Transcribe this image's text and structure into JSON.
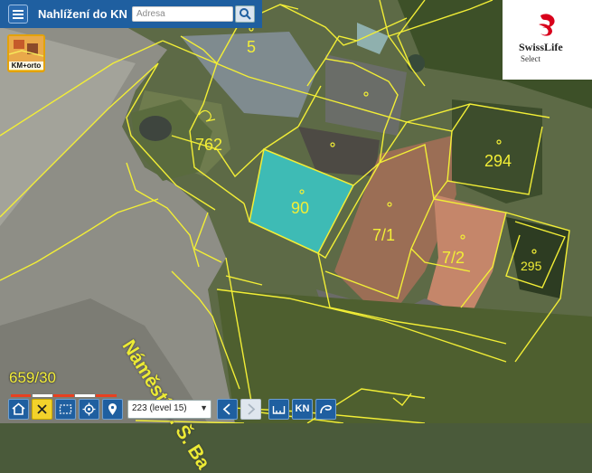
{
  "header": {
    "title": "Nahlížení do KN",
    "search_placeholder": "Adresa"
  },
  "brand": {
    "name": "SwissLife",
    "sub": "Select"
  },
  "layer_button": {
    "label": "KM+orto"
  },
  "map": {
    "parcels": [
      {
        "id": "5"
      },
      {
        "id": "762"
      },
      {
        "id": "90",
        "selected": true
      },
      {
        "id": "294"
      },
      {
        "id": "7/1"
      },
      {
        "id": "7/2"
      },
      {
        "id": "295"
      },
      {
        "id": "659/30"
      }
    ],
    "street_name": "Náměstí J. Š. Ba",
    "parcel_line_color": "#f2ee36",
    "selected_fill_color": "#38c9c9"
  },
  "toolbar": {
    "zoom_level": "223 (level 15)",
    "kn_label": "KN",
    "icons": [
      "home-icon",
      "close-icon",
      "select-area-icon",
      "locate-icon",
      "location-pin-icon",
      "dropdown-caret-icon",
      "arrow-left-icon",
      "arrow-right-icon",
      "measure-icon",
      "kn-icon",
      "draw-icon"
    ]
  }
}
